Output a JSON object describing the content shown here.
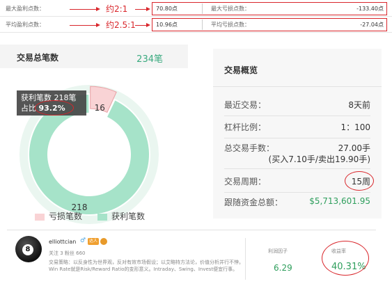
{
  "stats": {
    "row1": {
      "label": "最大盈利点数：",
      "ratio": "约2:1",
      "value": "70.80点",
      "label2": "最大亏损点数：",
      "value2": "-133.40点"
    },
    "row2": {
      "label": "平均盈利点数：",
      "ratio": "约2.5:1",
      "value": "10.96点",
      "label2": "平均亏损点数：",
      "value2": "-27.04点"
    }
  },
  "trades": {
    "title": "交易总笔数",
    "total": "234笔",
    "tooltip_line1": "获利笔数 218笔",
    "tooltip_line2_prefix": "占比",
    "tooltip_pct": "93.2%",
    "loss_slice_label": "16",
    "win_slice_label": "218",
    "legend_loss": "亏损笔数",
    "legend_win": "获利笔数",
    "colors": {
      "win": "#a6e3c9",
      "win_dark": "#8fd9b8",
      "loss": "#f9d3d5",
      "loss_border": "#e8a1a5"
    }
  },
  "chart_data": {
    "type": "pie",
    "categories": [
      "亏损笔数",
      "获利笔数"
    ],
    "values": [
      16,
      218
    ],
    "title": "交易总笔数"
  },
  "overview": {
    "title": "交易概览",
    "recent_label": "最近交易：",
    "recent_value": "8天前",
    "leverage_label": "杠杆比例：",
    "leverage_value": "1：100",
    "lots_label": "总交易手数：",
    "lots_value": "27.00手",
    "lots_detail": "(买入7.10手/卖出19.90手)",
    "cycle_label": "交易周期：",
    "cycle_value": "15周",
    "funds_label": "跟随资金总额：",
    "funds_value": "$5,713,601.95"
  },
  "profile": {
    "avatar_glyph": "8",
    "username": "elliottcian",
    "gender_icon": "male-icon",
    "badge_text": "达人",
    "follow_text": "关注 3   粉丝 660",
    "strategy_text": "交易策略：以反身性为世界观，反对有效市场假设；以艾略特方法论，价值分析并行不悖。Win Rate就是Risk/Reward Ratio的变形意义。Intraday、Swing、Invest便宜行事。",
    "profit_factor_label": "利润因子",
    "profit_factor_value": "6.29",
    "yield_label": "收益率",
    "yield_value": "40.31%"
  }
}
